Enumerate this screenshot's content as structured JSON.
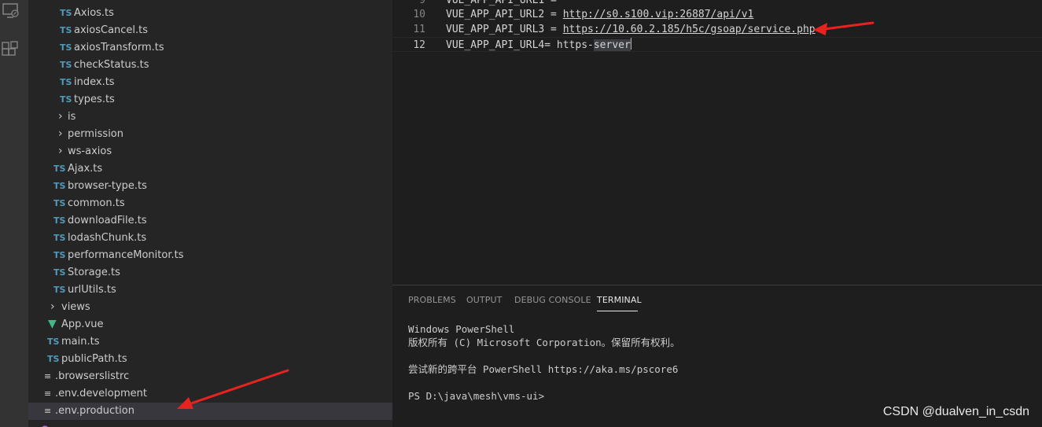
{
  "activity_bar": {
    "icons": [
      "remote-explorer-icon",
      "extensions-icon"
    ]
  },
  "explorer": {
    "items": [
      {
        "label": "Axios.ts",
        "icon": "ts-file-icon",
        "kind": "ts"
      },
      {
        "label": "axiosCancel.ts",
        "icon": "ts-file-icon",
        "kind": "ts"
      },
      {
        "label": "axiosTransform.ts",
        "icon": "ts-file-icon",
        "kind": "ts"
      },
      {
        "label": "checkStatus.ts",
        "icon": "ts-file-icon",
        "kind": "ts"
      },
      {
        "label": "index.ts",
        "icon": "ts-file-icon",
        "kind": "ts"
      },
      {
        "label": "types.ts",
        "icon": "ts-file-icon",
        "kind": "ts"
      },
      {
        "label": "is",
        "icon": "chevron-right-icon",
        "kind": "folder"
      },
      {
        "label": "permission",
        "icon": "chevron-right-icon",
        "kind": "folder"
      },
      {
        "label": "ws-axios",
        "icon": "chevron-right-icon",
        "kind": "folder"
      },
      {
        "label": "Ajax.ts",
        "icon": "ts-file-icon",
        "kind": "ts"
      },
      {
        "label": "browser-type.ts",
        "icon": "ts-file-icon",
        "kind": "ts"
      },
      {
        "label": "common.ts",
        "icon": "ts-file-icon",
        "kind": "ts"
      },
      {
        "label": "downloadFile.ts",
        "icon": "ts-file-icon",
        "kind": "ts"
      },
      {
        "label": "lodashChunk.ts",
        "icon": "ts-file-icon",
        "kind": "ts"
      },
      {
        "label": "performanceMonitor.ts",
        "icon": "ts-file-icon",
        "kind": "ts"
      },
      {
        "label": "Storage.ts",
        "icon": "ts-file-icon",
        "kind": "ts"
      },
      {
        "label": "urlUtils.ts",
        "icon": "ts-file-icon",
        "kind": "ts"
      },
      {
        "label": "views",
        "icon": "chevron-right-icon",
        "kind": "folder"
      },
      {
        "label": "App.vue",
        "icon": "vue-file-icon",
        "kind": "vue"
      },
      {
        "label": "main.ts",
        "icon": "ts-file-icon",
        "kind": "ts"
      },
      {
        "label": "publicPath.ts",
        "icon": "ts-file-icon",
        "kind": "ts"
      },
      {
        "label": ".browserslistrc",
        "icon": "text-file-icon",
        "kind": "text"
      },
      {
        "label": ".env.development",
        "icon": "text-file-icon",
        "kind": "text"
      },
      {
        "label": ".env.production",
        "icon": "text-file-icon",
        "kind": "text",
        "selected": true
      }
    ],
    "ts_badge": "TS"
  },
  "editor": {
    "lines": [
      {
        "number": "10",
        "key": "VUE_APP_API_URL2 = ",
        "value": "http://s0.s100.vip:26887/api/v1"
      },
      {
        "number": "11",
        "key": "VUE_APP_API_URL3 = ",
        "value": "https://10.60.2.185/h5c/gsoap/service.php"
      },
      {
        "number": "12",
        "key": "VUE_APP_API_URL4= ",
        "value": "https-",
        "value_hl": "server"
      }
    ]
  },
  "panel": {
    "tabs": [
      "PROBLEMS",
      "OUTPUT",
      "DEBUG CONSOLE",
      "TERMINAL"
    ],
    "active_tab": "TERMINAL",
    "terminal_lines": [
      "Windows PowerShell",
      "版权所有 (C) Microsoft Corporation。保留所有权利。",
      "",
      "尝试新的跨平台 PowerShell https://aka.ms/pscore6",
      "",
      "PS D:\\java\\mesh\\vms-ui>"
    ]
  },
  "watermark": "CSDN @dualven_in_csdn",
  "colors": {
    "annotation_arrow": "#e8231f",
    "ts_icon": "#519aba",
    "vue_icon": "#41b883"
  }
}
